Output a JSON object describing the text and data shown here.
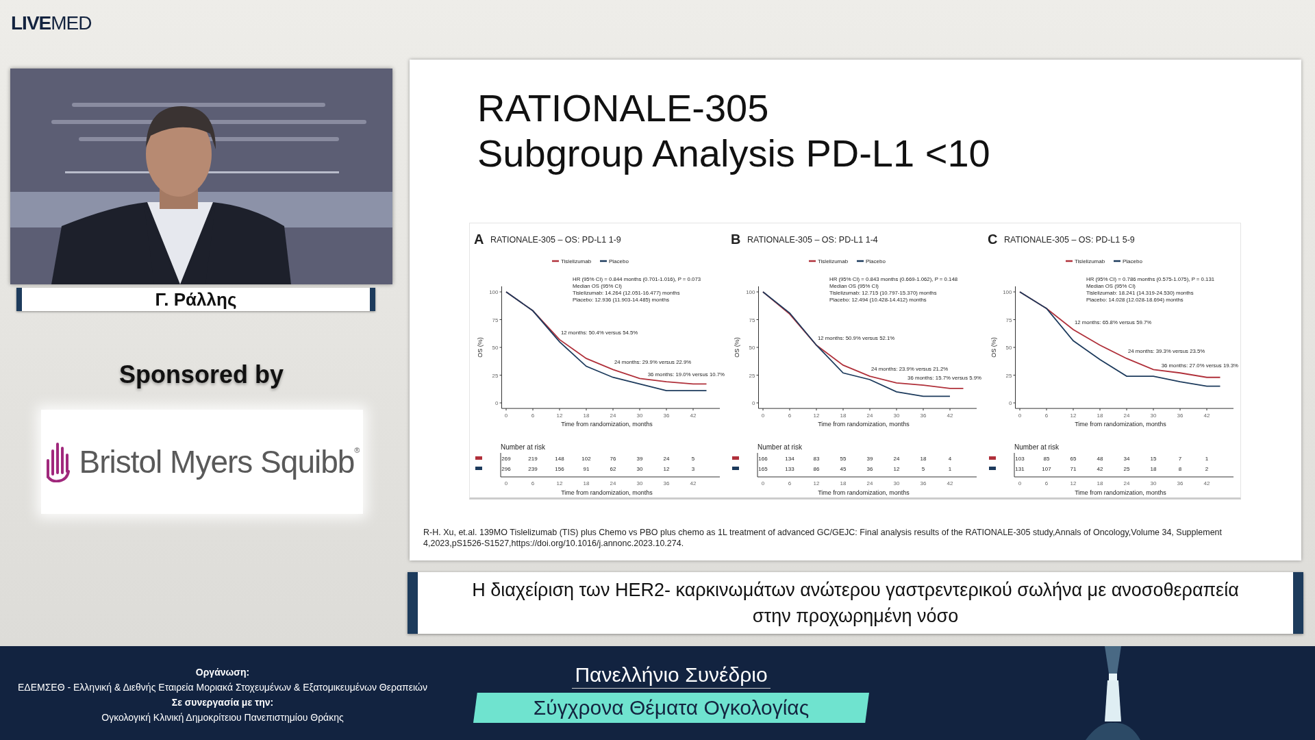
{
  "logo": "**LIVE**MED",
  "speaker": {
    "name": "Γ. Ράλλης"
  },
  "sponsor": {
    "heading": "Sponsored by",
    "logo_text": "Bristol Myers Squibb$^{®}$"
  },
  "slide": {
    "title_lines": [
      "RATIONALE-305",
      "Subgroup Analysis PD-L1 <10"
    ],
    "panels": [
      {
        "letter": "A",
        "chart_data": {
          "type": "line",
          "title": "RATIONALE-305 – OS: PD-L1 1-9",
          "xlabel": "Time from randomization, months",
          "ylabel": "OS (%)",
          "legend": true,
          "x": [
            0,
            6,
            12,
            18,
            24,
            30,
            36,
            42,
            45
          ],
          "xlim": [
            -1,
            48
          ],
          "xticks": [
            0,
            6,
            12,
            18,
            24,
            30,
            36,
            42
          ],
          "yticks": [
            0,
            25,
            50,
            75,
            100
          ],
          "ylim": [
            -5,
            105
          ],
          "series": [
            {
              "name": "Tislelizumab",
              "color": "#b0303a",
              "values": [
                100,
                83,
                57,
                40,
                30,
                22,
                19,
                17,
                17
              ]
            },
            {
              "name": "Placebo",
              "color": "#1c3a5c",
              "values": [
                100,
                83,
                55,
                33,
                23,
                17,
                11,
                11,
                11
              ]
            }
          ],
          "annotations": [
            "HR (95% CI) = 0.844 months (0.701-1.016), P = 0.073",
            "Median OS (95% CI)",
            "Tislelizumab: 14.264 (12.051-16.477) months",
            "Placebo: 12.936 (11.903-14.485) months",
            "12 months: 50.4% versus 54.5%",
            "24 months: 29.9% versus 22.9%",
            "36 months: 19.0% versus 10.7%"
          ]
        },
        "risk_table": {
          "heading": "Number at risk",
          "rows": [
            {
              "color": "#b0303a",
              "counts": [
                "269",
                "219",
                "148",
                "102",
                "76",
                "39",
                "24",
                "5"
              ]
            },
            {
              "color": "#1c3a5c",
              "counts": [
                "296",
                "239",
                "156",
                "91",
                "62",
                "30",
                "12",
                "3"
              ]
            }
          ],
          "xticks": [
            "0",
            "6",
            "12",
            "18",
            "24",
            "30",
            "36",
            "42"
          ],
          "xlabel": "Time from randomization, months"
        }
      },
      {
        "letter": "B",
        "chart_data": {
          "type": "line",
          "title": "RATIONALE-305 – OS: PD-L1 1-4",
          "xlabel": "Time from randomization, months",
          "ylabel": "OS (%)",
          "legend": true,
          "x": [
            0,
            6,
            12,
            18,
            24,
            30,
            36,
            42,
            45
          ],
          "xlim": [
            -1,
            48
          ],
          "xticks": [
            0,
            6,
            12,
            18,
            24,
            30,
            36,
            42
          ],
          "yticks": [
            0,
            25,
            50,
            75,
            100
          ],
          "ylim": [
            -5,
            105
          ],
          "series": [
            {
              "name": "Tislelizumab",
              "color": "#b0303a",
              "values": [
                100,
                80,
                52,
                34,
                24,
                18,
                16,
                13,
                13
              ]
            },
            {
              "name": "Placebo",
              "color": "#1c3a5c",
              "values": [
                100,
                81,
                52,
                27,
                21,
                10,
                6,
                6,
                null
              ]
            }
          ],
          "annotations": [
            "HR (95% CI) = 0.843 months (0.669-1.062), P = 0.148",
            "Median OS (95% CI)",
            "Tislelizumab: 12.715 (10.797-15.370) months",
            "Placebo: 12.494 (10.428-14.412) months",
            "12 months: 50.9% versus 52.1%",
            "24 months: 23.9% versus 21.2%",
            "36 months: 15.7% versus 5.9%"
          ]
        },
        "risk_table": {
          "heading": "Number at risk",
          "rows": [
            {
              "color": "#b0303a",
              "counts": [
                "166",
                "134",
                "83",
                "55",
                "39",
                "24",
                "18",
                "4"
              ]
            },
            {
              "color": "#1c3a5c",
              "counts": [
                "165",
                "133",
                "86",
                "45",
                "36",
                "12",
                "5",
                "1"
              ]
            }
          ],
          "xticks": [
            "0",
            "6",
            "12",
            "18",
            "24",
            "30",
            "36",
            "42"
          ],
          "xlabel": "Time from randomization, months"
        }
      },
      {
        "letter": "C",
        "chart_data": {
          "type": "line",
          "title": "RATIONALE-305 – OS: PD-L1 5-9",
          "xlabel": "Time from randomization, months",
          "ylabel": "OS (%)",
          "legend": true,
          "x": [
            0,
            6,
            12,
            18,
            24,
            30,
            36,
            42,
            45
          ],
          "xlim": [
            -1,
            48
          ],
          "xticks": [
            0,
            6,
            12,
            18,
            24,
            30,
            36,
            42
          ],
          "yticks": [
            0,
            25,
            50,
            75,
            100
          ],
          "ylim": [
            -5,
            105
          ],
          "series": [
            {
              "name": "Tislelizumab",
              "color": "#b0303a",
              "values": [
                100,
                85,
                66,
                52,
                40,
                30,
                27,
                23,
                23
              ]
            },
            {
              "name": "Placebo",
              "color": "#1c3a5c",
              "values": [
                100,
                85,
                56,
                39,
                24,
                24,
                19,
                15,
                15
              ]
            }
          ],
          "annotations": [
            "HR (95% CI) = 0.786 months (0.575-1.075), P = 0.131",
            "Median OS (95% CI)",
            "Tislelizumab: 18.241 (14.319-24.530) months",
            "Placebo: 14.028 (12.028-18.694) months",
            "12 months: 65.8% versus 59.7%",
            "24 months: 39.3% versus 23.5%",
            "36 months: 27.0% versus 19.3%"
          ]
        },
        "risk_table": {
          "heading": "Number at risk",
          "rows": [
            {
              "color": "#b0303a",
              "counts": [
                "103",
                "85",
                "65",
                "48",
                "34",
                "15",
                "7",
                "1"
              ]
            },
            {
              "color": "#1c3a5c",
              "counts": [
                "131",
                "107",
                "71",
                "42",
                "25",
                "18",
                "8",
                "2"
              ]
            }
          ],
          "xticks": [
            "0",
            "6",
            "12",
            "18",
            "24",
            "30",
            "36",
            "42"
          ],
          "xlabel": "Time from randomization, months"
        }
      }
    ],
    "reference": "R-H. Xu, et.al. 139MO Tislelizumab (TIS) plus Chemo vs PBO plus chemo as 1L treatment of advanced GC/GEJC: Final analysis results of the RATIONALE-305 study,Annals of Oncology,Volume 34, Supplement 4,2023,pS1526-S1527,https://doi.org/10.1016/j.annonc.2023.10.274."
  },
  "caption": "Η διαχείριση των HER2- καρκινωμάτων ανώτερου γαστρεντερικού σωλήνα με ανοσοθεραπεία στην προχωρημένη νόσο",
  "footer": {
    "organizer_label": "Οργάνωση:",
    "organizer": "ΕΔΕΜΣΕΘ - Ελληνική & Διεθνής Εταιρεία Μοριακά Στοχευμένων & Εξατομικευμένων Θεραπειών",
    "partner_label": "Σε συνεργασία με την:",
    "partner": "Ογκολογική Κλινική Δημοκρίτειου Πανεπιστημίου Θράκης",
    "event_title": "Πανελλήνιο Συνέδριο",
    "event_subtitle": "Σύγχρονα Θέματα Ογκολογίας"
  }
}
